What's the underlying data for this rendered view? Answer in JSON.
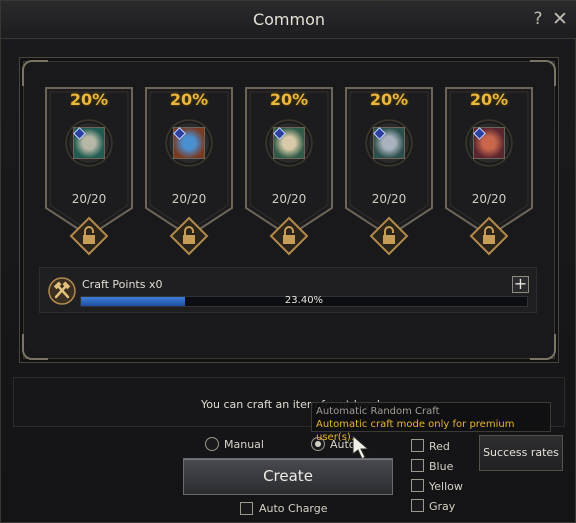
{
  "window": {
    "title": "Common",
    "help_label": "?",
    "close_label": "✕"
  },
  "slots": [
    {
      "chance": "20%",
      "count": "20/20",
      "item": "helmet-icon",
      "color": "#1f5d52"
    },
    {
      "chance": "20%",
      "count": "20/20",
      "item": "gauntlet-icon",
      "color": "#7a3a22"
    },
    {
      "chance": "20%",
      "count": "20/20",
      "item": "pants-icon",
      "color": "#2f5b48"
    },
    {
      "chance": "20%",
      "count": "20/20",
      "item": "boots-icon",
      "color": "#2b4f4a"
    },
    {
      "chance": "20%",
      "count": "20/20",
      "item": "axe-icon",
      "color": "#5b2530"
    }
  ],
  "craft_points": {
    "label": "Craft Points x0",
    "progress_percent": 23.4,
    "progress_text": "23.40%",
    "plus_label": "+"
  },
  "info": {
    "text": "You can craft an item fr...nt level"
  },
  "tooltip": {
    "title": "Automatic Random Craft",
    "body": "Automatic craft mode only for premium user(s)."
  },
  "mode": {
    "manual_label": "Manual",
    "auto_label": "Auto",
    "selected": "auto"
  },
  "create_label": "Create",
  "auto_charge_label": "Auto Charge",
  "filters": [
    {
      "label": "Red",
      "checked": false
    },
    {
      "label": "Blue",
      "checked": false
    },
    {
      "label": "Yellow",
      "checked": false
    },
    {
      "label": "Gray",
      "checked": false
    }
  ],
  "success_rates_label": "Success rates",
  "colors": {
    "accent_gold": "#e9b73c",
    "progress_blue": "#3f7fd8",
    "tooltip_gold": "#e8b52b"
  }
}
